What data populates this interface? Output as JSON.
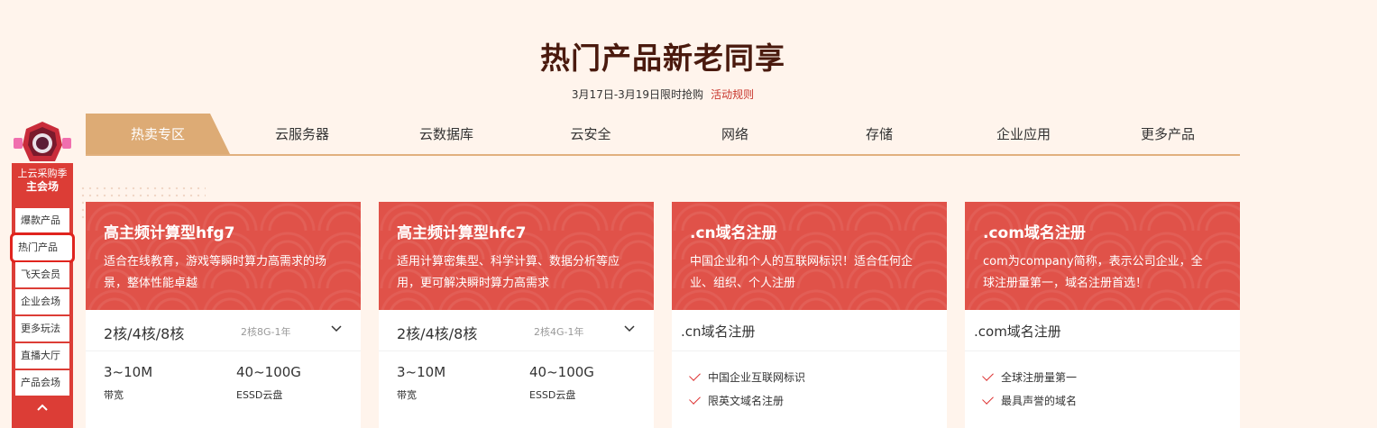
{
  "page": {
    "title": "热门产品新老同享",
    "subtitle": "3月17日-3月19日限时抢购",
    "rules_link": "活动规则"
  },
  "tabs": [
    "热卖专区",
    "云服务器",
    "云数据库",
    "云安全",
    "网络",
    "存储",
    "企业应用",
    "更多产品"
  ],
  "active_tab": "热卖专区",
  "sidebar": {
    "heading_line1": "上云采购季",
    "heading_line2": "主会场",
    "items": [
      "爆款产品",
      "热门产品",
      "飞天会员",
      "企业会场",
      "更多玩法",
      "直播大厅",
      "产品会场"
    ],
    "highlighted": "热门产品",
    "back_to_top_icon": "chevron-up-icon"
  },
  "cards": [
    {
      "title": "高主频计算型hfg7",
      "desc": "适合在线教育，游戏等瞬时算力高需求的场景，整体性能卓越",
      "select_main": "2核/4核/8核",
      "select_sub": "2核8G-1年",
      "spec1_value": "3~10M",
      "spec1_label": "带宽",
      "spec2_value": "40~100G",
      "spec2_label": "ESSD云盘"
    },
    {
      "title": "高主频计算型hfc7",
      "desc": "适用计算密集型、科学计算、数据分析等应用，更可解决瞬时算力高需求",
      "select_main": "2核/4核/8核",
      "select_sub": "2核4G-1年",
      "spec1_value": "3~10M",
      "spec1_label": "带宽",
      "spec2_value": "40~100G",
      "spec2_label": "ESSD云盘"
    },
    {
      "title": ".cn域名注册",
      "desc": "中国企业和个人的互联网标识！适合任何企业、组织、个人注册",
      "select_main": ".cn域名注册",
      "features": [
        "中国企业互联网标识",
        "限英文域名注册"
      ]
    },
    {
      "title": ".com域名注册",
      "desc": "com为company简称，表示公司企业，全球注册量第一，域名注册首选！",
      "select_main": ".com域名注册",
      "features": [
        "全球注册量第一",
        "最具声誉的域名"
      ]
    }
  ],
  "colors": {
    "accent_red": "#e05249",
    "tab_active": "#ddab75",
    "background": "#fff4ec",
    "title": "#4a1a0e"
  }
}
